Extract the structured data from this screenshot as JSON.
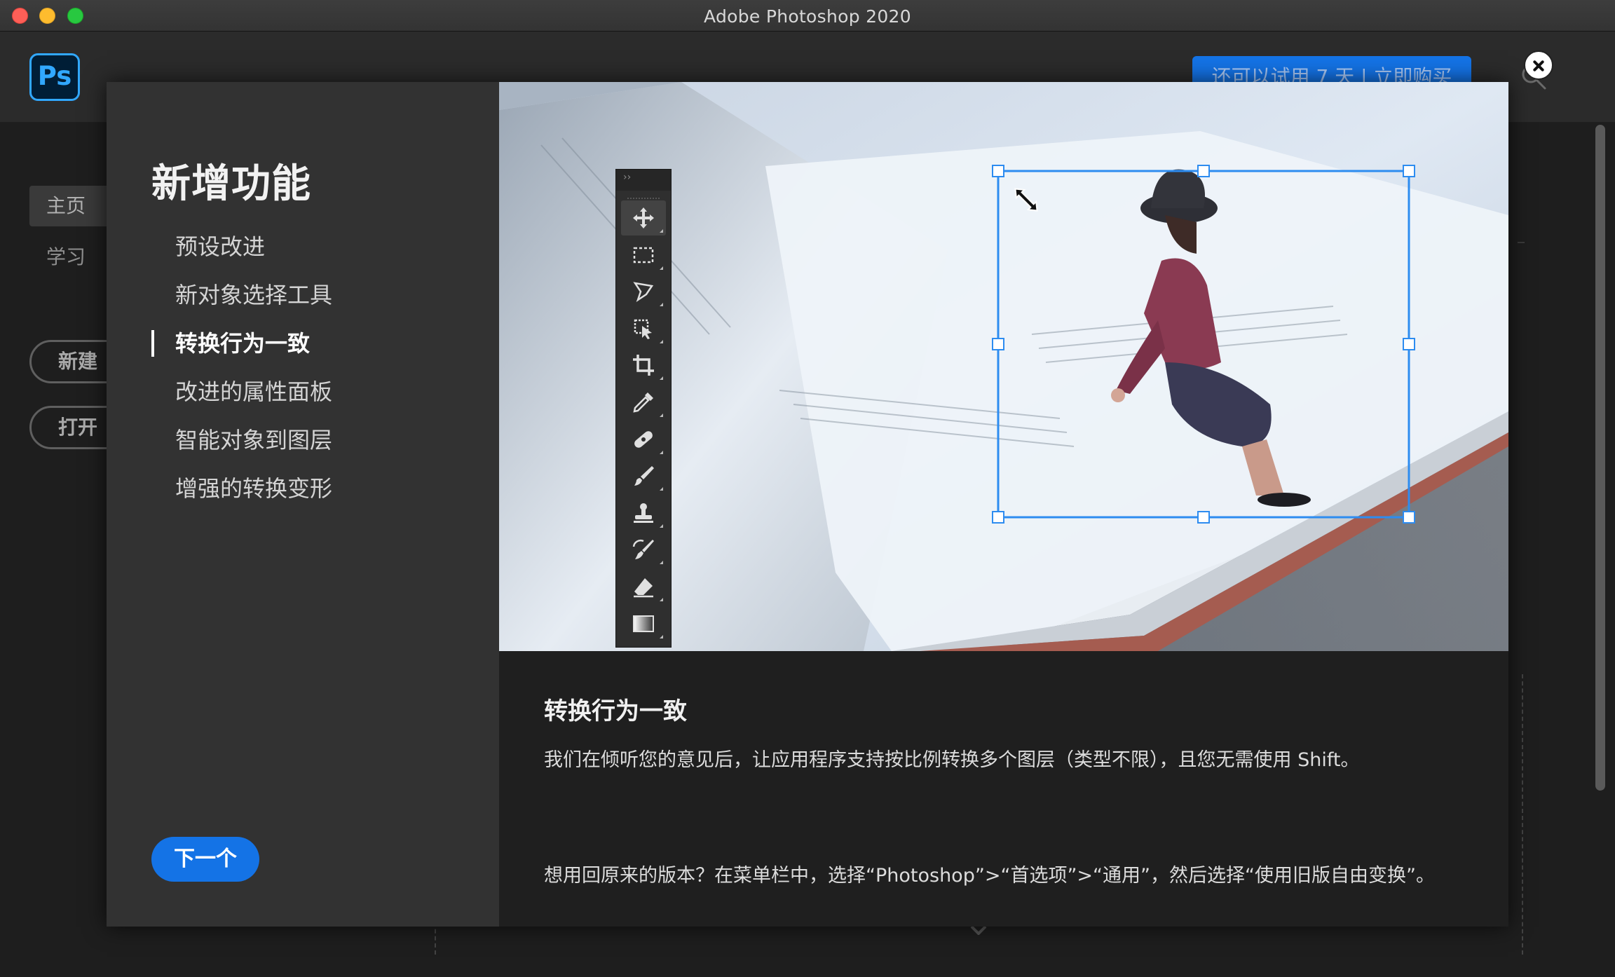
{
  "window": {
    "title": "Adobe Photoshop 2020"
  },
  "home": {
    "trial_banner": "还可以试用 7 天 | 立即购买",
    "nav": [
      {
        "label": "主页"
      },
      {
        "label": "学习"
      }
    ],
    "buttons": {
      "new": "新建",
      "open": "打开"
    }
  },
  "modal": {
    "heading": "新增功能",
    "features": [
      {
        "label": "预设改进"
      },
      {
        "label": "新对象选择工具"
      },
      {
        "label": "转换行为一致"
      },
      {
        "label": "改进的属性面板"
      },
      {
        "label": "智能对象到图层"
      },
      {
        "label": "增强的转换变形"
      }
    ],
    "next_button": "下一个",
    "detail": {
      "title": "转换行为一致",
      "description": "我们在倾听您的意见后，让应用程序支持按比例转换多个图层（类型不限），且您无需使用 Shift。",
      "footnote": "想用回原来的版本？在菜单栏中，选择“Photoshop”>“首选项”>“通用”，然后选择“使用旧版自由变换”。"
    },
    "toolbar_header": "››",
    "tools": [
      "move-tool-icon",
      "marquee-tool-icon",
      "lasso-tool-icon",
      "object-selection-tool-icon",
      "crop-tool-icon",
      "eyedropper-tool-icon",
      "healing-brush-tool-icon",
      "brush-tool-icon",
      "clone-stamp-tool-icon",
      "history-brush-tool-icon",
      "eraser-tool-icon",
      "gradient-tool-icon"
    ]
  },
  "colors": {
    "accent": "#1473e6",
    "selection_box": "#2d8cf0",
    "modal_left_bg": "#323232",
    "modal_bottom_bg": "#1f1f1f"
  }
}
